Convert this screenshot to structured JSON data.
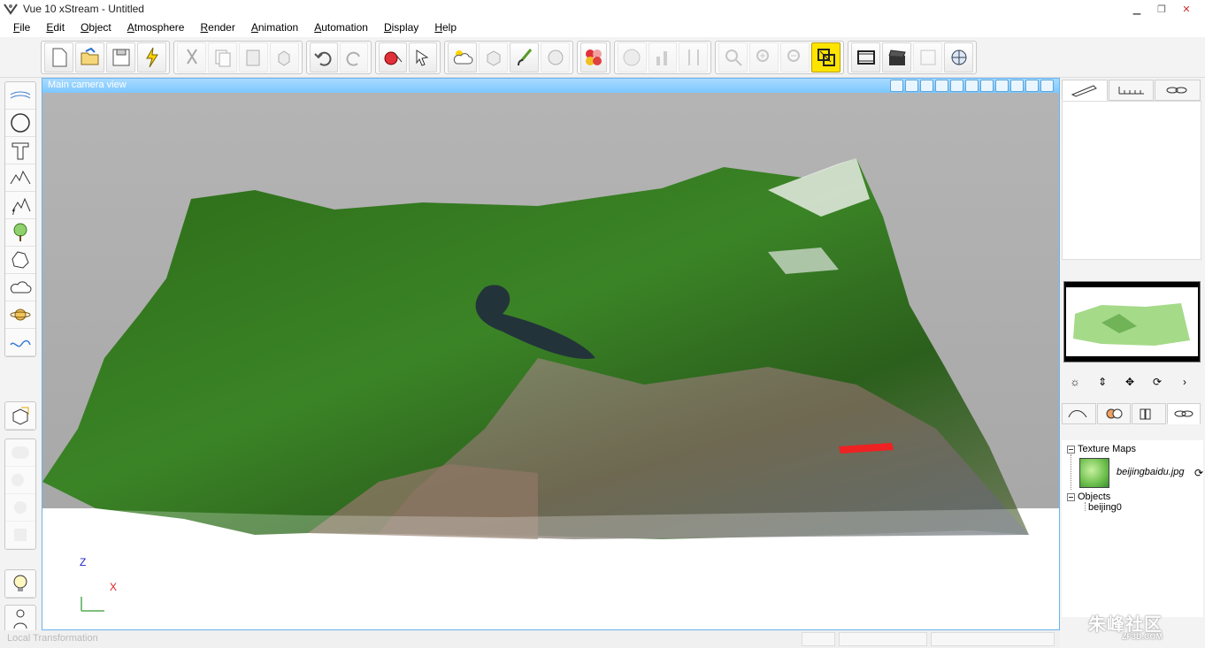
{
  "window": {
    "title": "Vue 10 xStream - Untitled"
  },
  "menu": [
    {
      "label": "File",
      "u": "F",
      "rest": "ile"
    },
    {
      "label": "Edit",
      "u": "E",
      "rest": "dit"
    },
    {
      "label": "Object",
      "u": "O",
      "rest": "bject"
    },
    {
      "label": "Atmosphere",
      "u": "A",
      "rest": "tmosphere"
    },
    {
      "label": "Render",
      "u": "R",
      "rest": "ender"
    },
    {
      "label": "Animation",
      "u": "A",
      "rest": "nimation"
    },
    {
      "label": "Automation",
      "u": "A",
      "rest": "utomation"
    },
    {
      "label": "Display",
      "u": "D",
      "rest": "isplay"
    },
    {
      "label": "Help",
      "u": "H",
      "rest": "elp"
    }
  ],
  "viewport": {
    "title": "Main camera view",
    "axis_z": "Z",
    "axis_x": "X"
  },
  "world_browser": {
    "texture_maps_label": "Texture Maps",
    "texture_file": "beijingbaidu.jpg",
    "objects_label": "Objects",
    "object_name": "beijing0"
  },
  "statusbar": {
    "text": "Local Transformation"
  },
  "watermark": {
    "text": "朱峰社区",
    "sub": "ZF3D.COM"
  },
  "colors": {
    "accent": "#7cc7ff",
    "active_tool": "#ffe400",
    "terrain": "#2f6b1f"
  }
}
